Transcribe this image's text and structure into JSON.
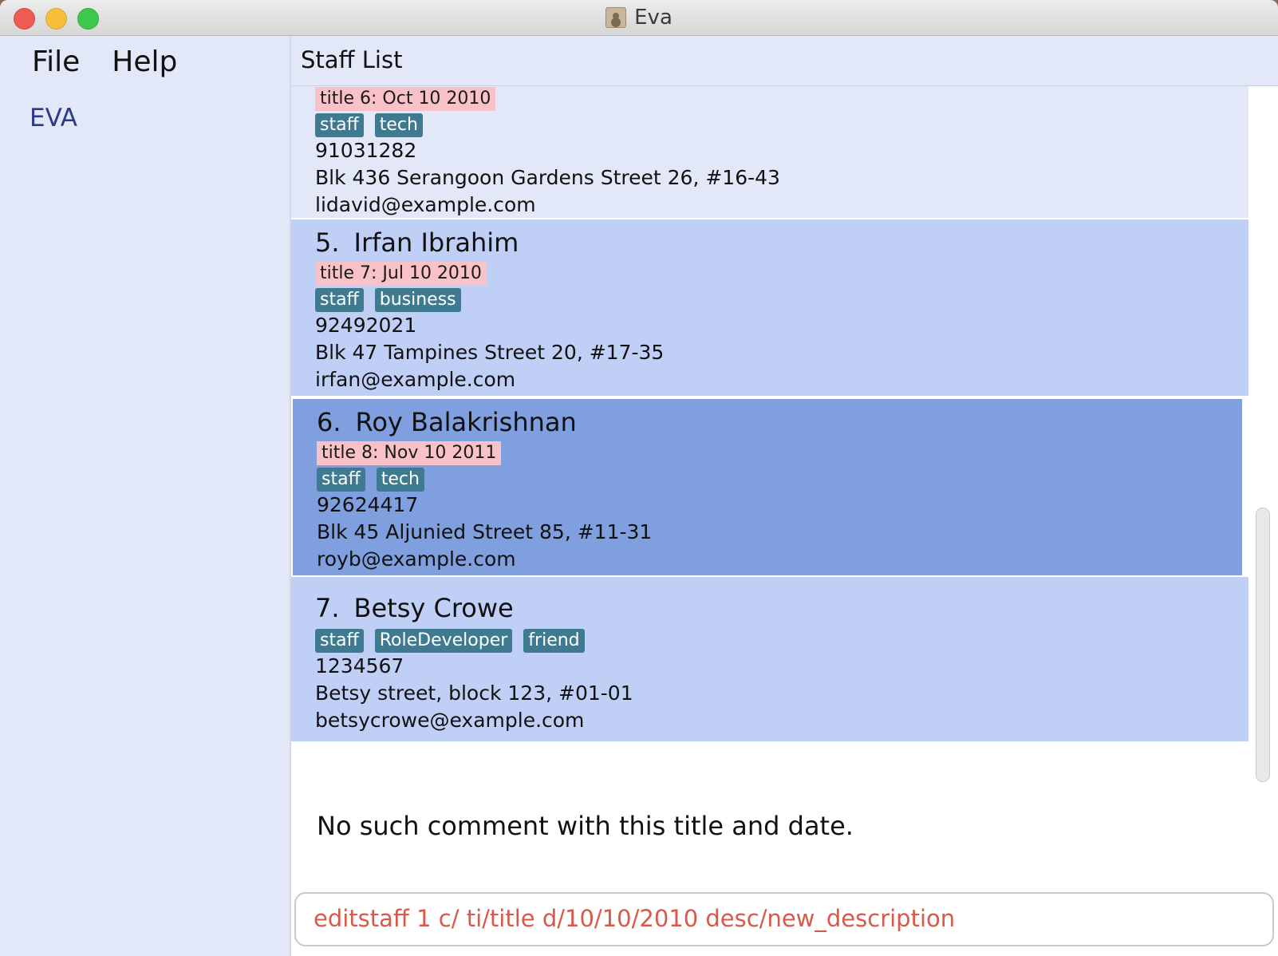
{
  "window": {
    "title": "Eva"
  },
  "menu": {
    "file": "File",
    "help": "Help"
  },
  "sidebar": {
    "brand": "EVA"
  },
  "list": {
    "header": "Staff List",
    "cards": [
      {
        "number": "",
        "name": "",
        "comment": "title 6: Oct 10 2010",
        "tags": [
          "staff",
          "tech"
        ],
        "phone": "91031282",
        "address": "Blk 436 Serangoon Gardens Street 26, #16-43",
        "email": "lidavid@example.com"
      },
      {
        "number": "5.",
        "name": "Irfan Ibrahim",
        "comment": "title 7: Jul 10 2010",
        "tags": [
          "staff",
          "business"
        ],
        "phone": "92492021",
        "address": "Blk 47 Tampines Street 20, #17-35",
        "email": "irfan@example.com"
      },
      {
        "number": "6.",
        "name": "Roy Balakrishnan",
        "comment": "title 8: Nov 10 2011",
        "tags": [
          "staff",
          "tech"
        ],
        "phone": "92624417",
        "address": "Blk 45 Aljunied Street 85, #11-31",
        "email": "royb@example.com",
        "selected": true
      },
      {
        "number": "7.",
        "name": "Betsy Crowe",
        "tags": [
          "staff",
          "RoleDeveloper",
          "friend"
        ],
        "phone": "1234567",
        "address": "Betsy street, block 123, #01-01",
        "email": "betsycrowe@example.com"
      }
    ]
  },
  "result": {
    "message": "No such comment with this title and date."
  },
  "command": {
    "value": "editstaff 1 c/ ti/title d/10/10/2010 desc/new_description"
  },
  "colors": {
    "card_alt": "#e2e8f8",
    "card_std": "#bfcff6",
    "card_selected": "#7f9fdf",
    "tag": "#3e7b91",
    "comment_tag": "#f8c2c8",
    "command_text": "#d8584a"
  }
}
